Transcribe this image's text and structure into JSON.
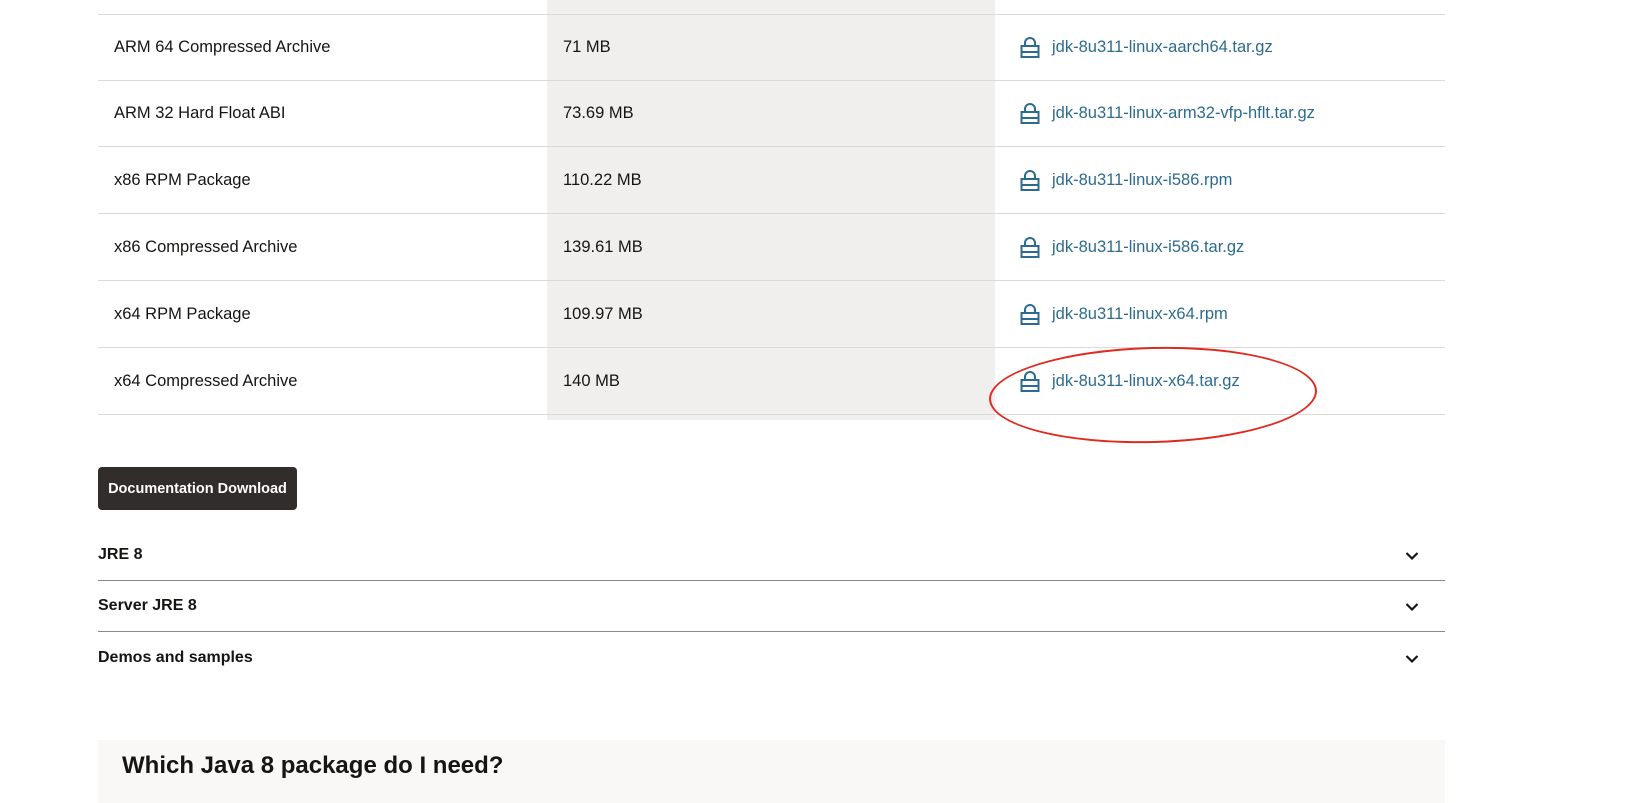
{
  "downloads": {
    "rows": [
      {
        "product": "ARM 64 Compressed Archive",
        "size": "71 MB",
        "file": "jdk-8u311-linux-aarch64.tar.gz"
      },
      {
        "product": "ARM 32 Hard Float ABI",
        "size": "73.69 MB",
        "file": "jdk-8u311-linux-arm32-vfp-hflt.tar.gz"
      },
      {
        "product": "x86 RPM Package",
        "size": "110.22 MB",
        "file": "jdk-8u311-linux-i586.rpm"
      },
      {
        "product": "x86 Compressed Archive",
        "size": "139.61 MB",
        "file": "jdk-8u311-linux-i586.tar.gz"
      },
      {
        "product": "x64 RPM Package",
        "size": "109.97 MB",
        "file": "jdk-8u311-linux-x64.rpm"
      },
      {
        "product": "x64 Compressed Archive",
        "size": "140 MB",
        "file": "jdk-8u311-linux-x64.tar.gz"
      }
    ],
    "link_icon": "lock-icon"
  },
  "documentation_button": {
    "label": "Documentation Download"
  },
  "accordions": [
    {
      "title": "JRE 8",
      "icon": "chevron-down-icon"
    },
    {
      "title": "Server JRE 8",
      "icon": "chevron-down-icon"
    },
    {
      "title": "Demos and samples",
      "icon": "chevron-down-icon"
    }
  ],
  "which_package": {
    "heading": "Which Java 8 package do I need?"
  },
  "colors": {
    "link": "#2c6b8f",
    "shaded_column": "#f1efed",
    "button_bg": "#312d2a",
    "annotation": "#e02a1f"
  }
}
